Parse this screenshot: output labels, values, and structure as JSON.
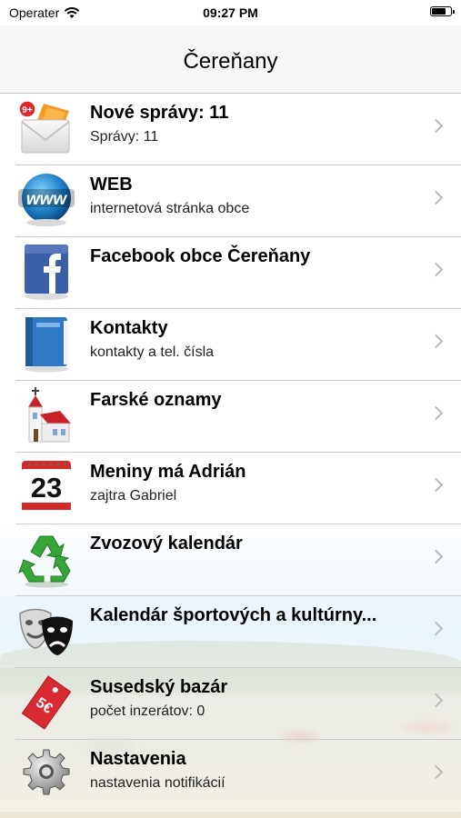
{
  "status": {
    "carrier": "Operater",
    "time": "09:27 PM",
    "battery": 0.8
  },
  "navbar": {
    "title": "Čereňany"
  },
  "rows": [
    {
      "title": "Nové správy: 11",
      "subtitle": "Správy: 11",
      "icon": "mail-icon",
      "badge": "9+"
    },
    {
      "title": "WEB",
      "subtitle": "internetová stránka obce",
      "icon": "globe-www-icon"
    },
    {
      "title": "Facebook obce Čereňany",
      "subtitle": "",
      "icon": "facebook-icon"
    },
    {
      "title": "Kontakty",
      "subtitle": "kontakty a tel. čísla",
      "icon": "address-book-icon"
    },
    {
      "title": "Farské oznamy",
      "subtitle": "",
      "icon": "church-icon"
    },
    {
      "title": "Meniny má Adrián",
      "subtitle": "zajtra Gabriel",
      "icon": "calendar-icon",
      "date": "23"
    },
    {
      "title": "Zvozový kalendár",
      "subtitle": "",
      "icon": "recycle-icon"
    },
    {
      "title": "Kalendár športových a kultúrny...",
      "subtitle": "",
      "icon": "theater-masks-icon"
    },
    {
      "title": "Susedský bazár",
      "subtitle": "počet inzerátov: 0",
      "icon": "price-tag-icon",
      "tag": "5€"
    },
    {
      "title": "Nastavenia",
      "subtitle": "nastavenia notifikácií",
      "icon": "gear-icon"
    }
  ],
  "colors": {
    "accent_red": "#d8262a",
    "separator": "#c8c7cc",
    "chevron": "#b8b8bd"
  }
}
